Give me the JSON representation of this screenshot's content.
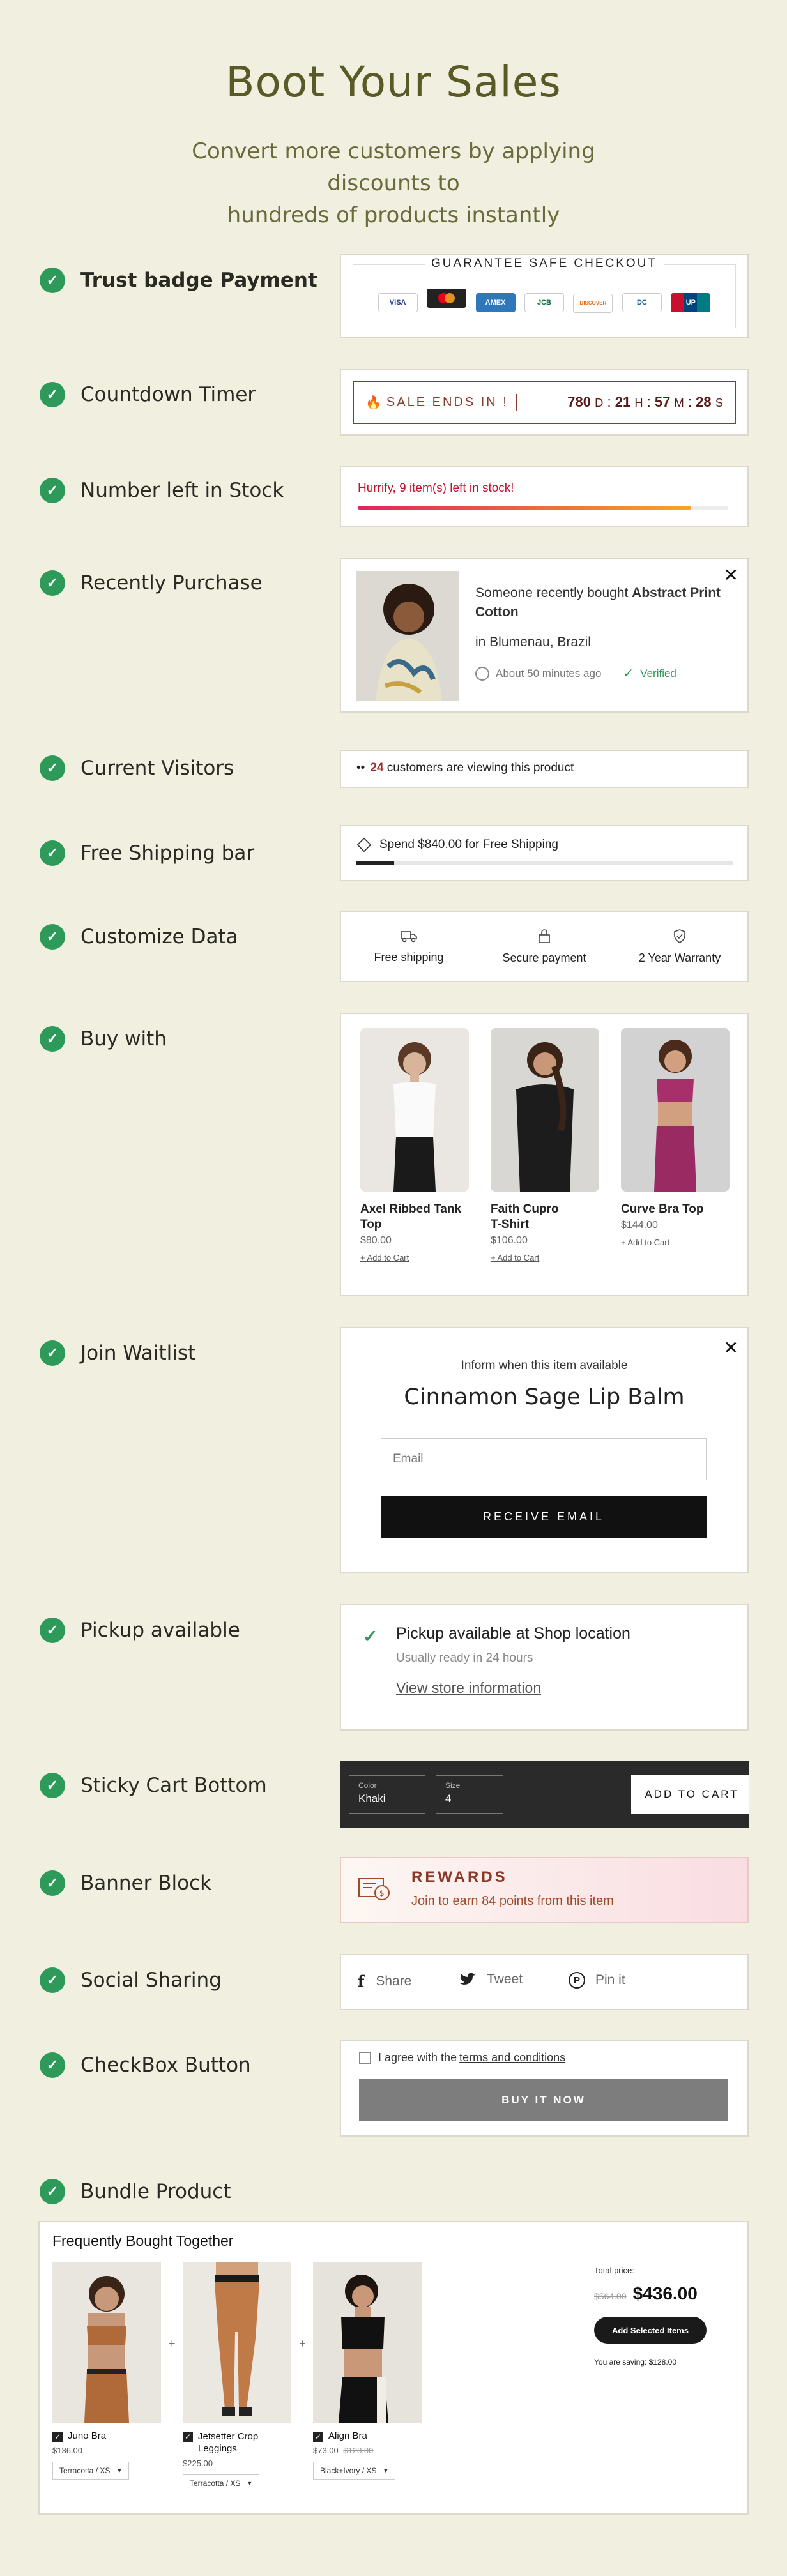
{
  "header": {
    "title": "Boot Your Sales",
    "subtitle_line1": "Convert more customers by applying discounts to",
    "subtitle_line2": "hundreds of products instantly"
  },
  "features": [
    {
      "label": "Trust badge Payment"
    },
    {
      "label": "Countdown Timer"
    },
    {
      "label": "Number left in Stock"
    },
    {
      "label": "Recently Purchase"
    },
    {
      "label": "Current Visitors"
    },
    {
      "label": "Free Shipping bar"
    },
    {
      "label": "Customize Data"
    },
    {
      "label": "Buy with"
    },
    {
      "label": "Join Waitlist"
    },
    {
      "label": "Pickup available"
    },
    {
      "label": "Sticky Cart Bottom"
    },
    {
      "label": "Banner Block"
    },
    {
      "label": "Social Sharing"
    },
    {
      "label": "CheckBox Button"
    },
    {
      "label": "Bundle Product"
    }
  ],
  "trust": {
    "heading": "GUARANTEE SAFE CHECKOUT",
    "cards": [
      {
        "label": "VISA",
        "color": "#1a3a8a"
      },
      {
        "label": "MC",
        "color": "#222"
      },
      {
        "label": "AMEX",
        "color": "#2e77bb"
      },
      {
        "label": "JCB",
        "color": "#0b6e3a"
      },
      {
        "label": "DISCOVER",
        "color": "#e8e8e8"
      },
      {
        "label": "DC",
        "color": "#0a5aa0"
      },
      {
        "label": "UP",
        "color": "#c8102e"
      }
    ]
  },
  "countdown": {
    "label": "SALE ENDS IN !",
    "days": "780",
    "days_unit": "D",
    "hours": "21",
    "hours_unit": "H",
    "mins": "57",
    "mins_unit": "M",
    "secs": "28",
    "secs_unit": "S"
  },
  "stock": {
    "text": "Hurrify, 9 item(s) left in stock!",
    "fill_fraction": 0.9
  },
  "recent": {
    "prefix": "Someone recently bought ",
    "product": "Abstract Print Cotton",
    "location": "in Blumenau, Brazil",
    "time": "About 50 minutes ago",
    "verified": "Verified"
  },
  "visitors": {
    "count": "24",
    "text": " customers are viewing this product"
  },
  "shipping": {
    "text": "Spend $840.00 for Free Shipping",
    "fill_fraction": 0.1
  },
  "custom_data": [
    {
      "icon": "truck-icon",
      "label": "Free shipping"
    },
    {
      "icon": "lock-icon",
      "label": "Secure payment"
    },
    {
      "icon": "shield-icon",
      "label": "2 Year Warranty"
    }
  ],
  "buy_with": [
    {
      "name_l1": "Axel Ribbed Tank",
      "name_l2": "Top",
      "price": "$80.00",
      "cta": "+ Add to Cart"
    },
    {
      "name_l1": "Faith Cupro",
      "name_l2": "T-Shirt",
      "price": "$106.00",
      "cta": "+ Add to Cart"
    },
    {
      "name_l1": "Curve Bra Top",
      "name_l2": "",
      "price": "$144.00",
      "cta": "+ Add to Cart"
    }
  ],
  "waitlist": {
    "intro": "Inform when this item available",
    "product": "Cinnamon Sage Lip Balm",
    "email_placeholder": "Email",
    "button": "RECEIVE EMAIL"
  },
  "pickup": {
    "title": "Pickup available at Shop location",
    "subtitle": "Usually ready in 24 hours",
    "link": "View store information"
  },
  "sticky": {
    "color_label": "Color",
    "color_value": "Khaki",
    "size_label": "Size",
    "size_value": "4",
    "button": "ADD TO CART"
  },
  "banner": {
    "title": "REWARDS",
    "text": "Join to earn 84 points from this item"
  },
  "social": [
    {
      "icon": "facebook-icon",
      "label": "Share"
    },
    {
      "icon": "twitter-icon",
      "label": "Tweet"
    },
    {
      "icon": "pinterest-icon",
      "label": "Pin it"
    }
  ],
  "checkbox": {
    "prefix": "I agree with the ",
    "link": "terms and conditions",
    "button": "BUY IT NOW"
  },
  "bundle": {
    "title": "Frequently Bought Together",
    "items": [
      {
        "name_l1": "Juno Bra",
        "name_l2": "",
        "price": "$136.00",
        "old_price": "",
        "variant": "Terracotta / XS"
      },
      {
        "name_l1": "Jetsetter Crop",
        "name_l2": "Leggings",
        "price": "$225.00",
        "old_price": "",
        "variant": "Terracotta / XS"
      },
      {
        "name_l1": "Align Bra",
        "name_l2": "",
        "price": "$73.00",
        "old_price": "$128.00",
        "variant": "Black+Ivory / XS"
      }
    ],
    "total_label": "Total price:",
    "old_total": "$564.00",
    "total": "$436.00",
    "button": "Add Selected Items",
    "saving": "You are saving: $128.00"
  }
}
